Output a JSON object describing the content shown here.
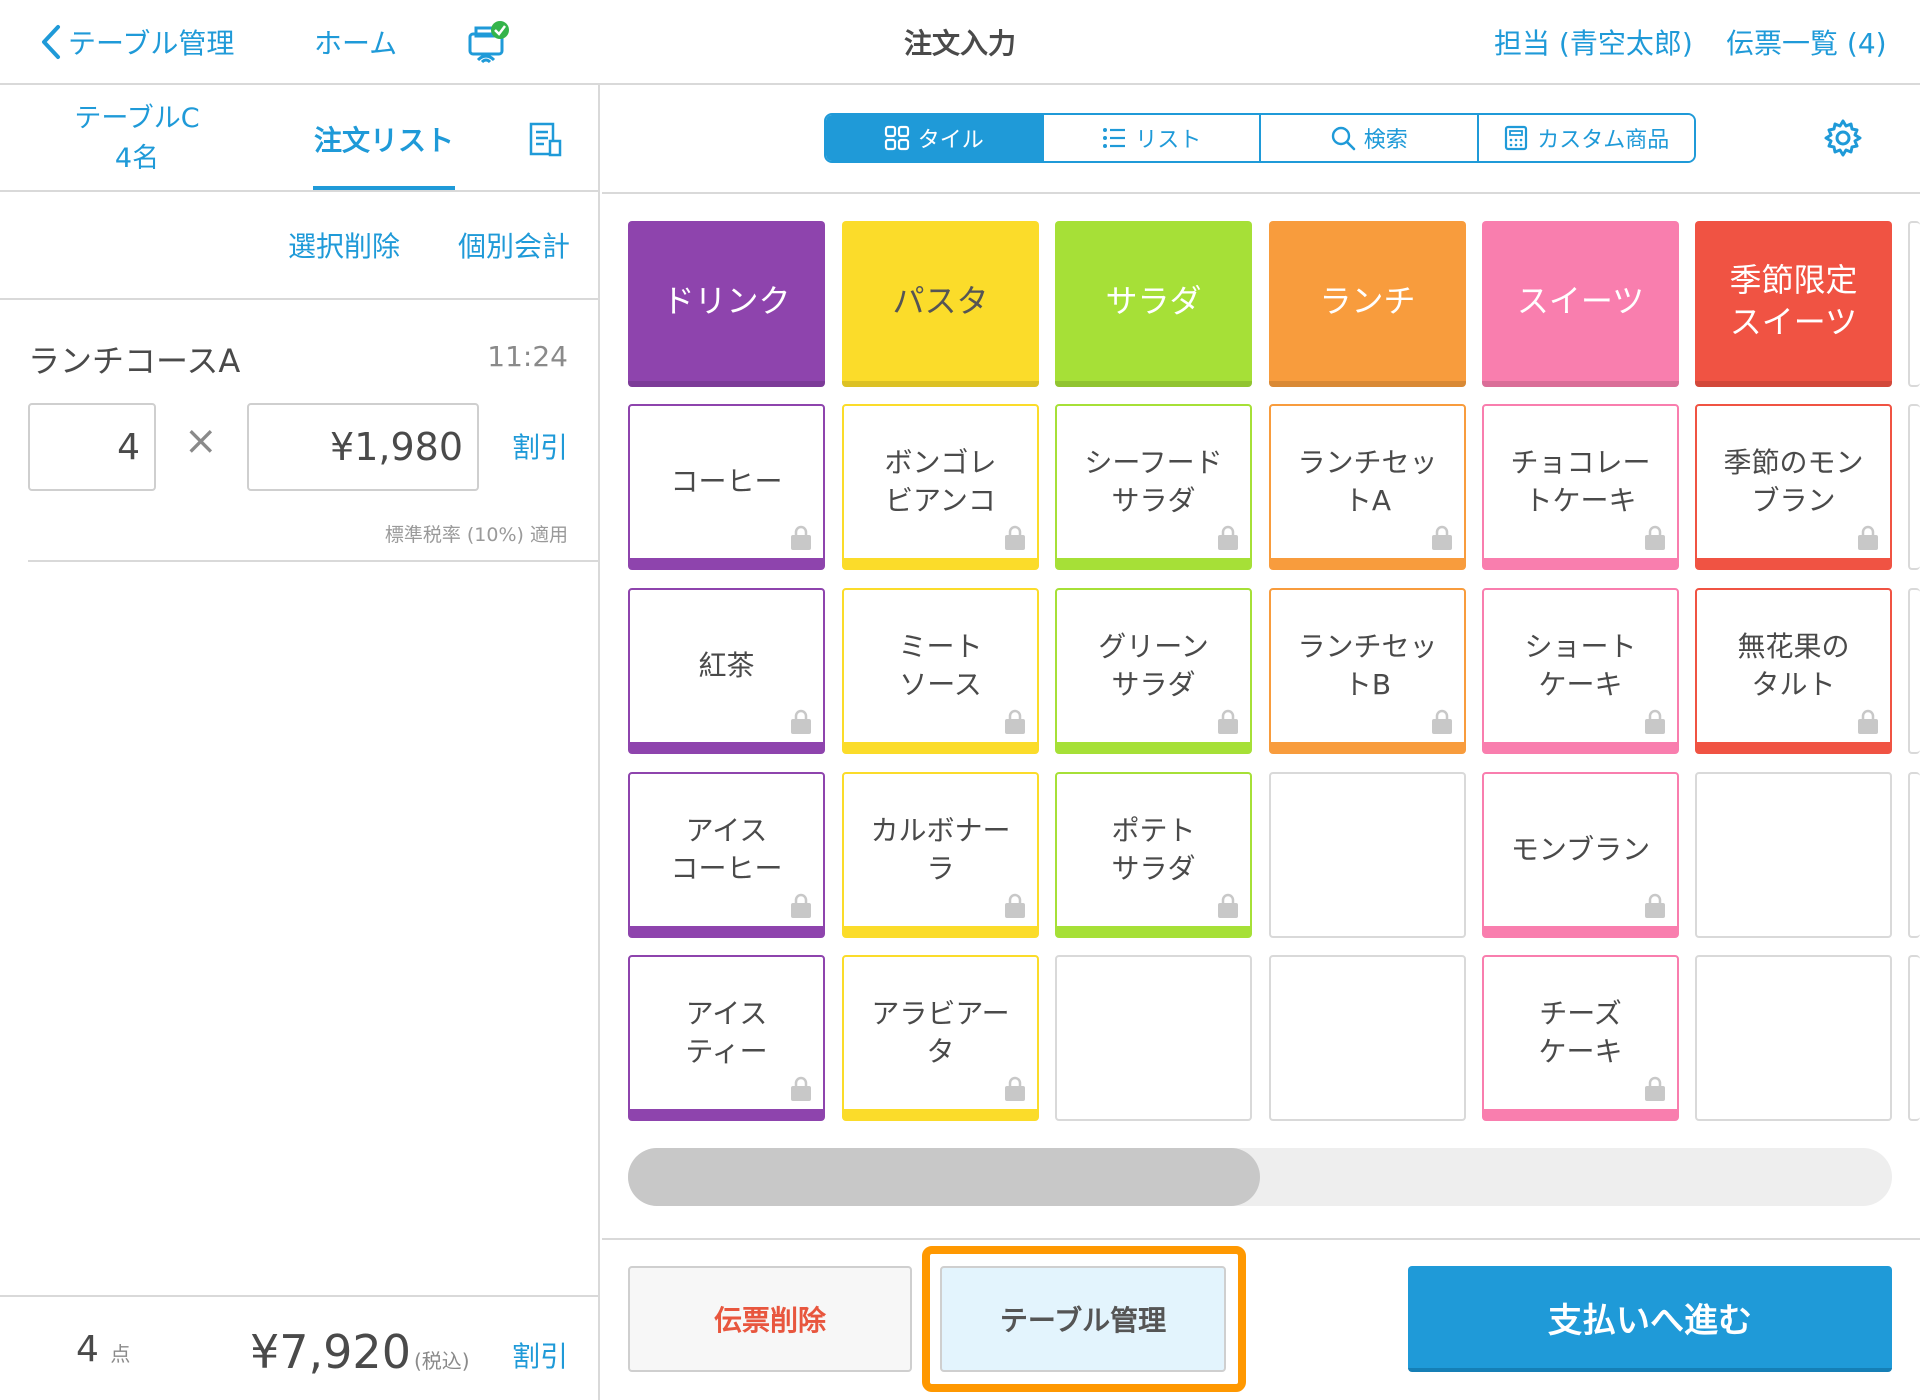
{
  "header": {
    "back_label": "テーブル管理",
    "home_label": "ホーム",
    "title": "注文入力",
    "staff_label": "担当 (青空太郎)",
    "slips_label": "伝票一覧 (4)"
  },
  "left": {
    "table_name": "テーブルC",
    "guests": "4名",
    "order_list_tab": "注文リスト",
    "delete_selected": "選択削除",
    "split_bill": "個別会計",
    "item": {
      "name": "ランチコースA",
      "time": "11:24",
      "quantity": "4",
      "times_symbol": "×",
      "price": "¥1,980",
      "discount": "割引",
      "tax_note": "標準税率 (10%) 適用"
    },
    "footer": {
      "count": "4",
      "count_unit": "点",
      "total": "¥7,920",
      "tax_included": "(税込)",
      "discount": "割引"
    }
  },
  "view_modes": [
    {
      "label": "タイル",
      "icon": "tile-grid-icon",
      "active": true
    },
    {
      "label": "リスト",
      "icon": "list-icon",
      "active": false
    },
    {
      "label": "検索",
      "icon": "search-icon",
      "active": false
    },
    {
      "label": "カスタム商品",
      "icon": "calculator-icon",
      "active": false
    }
  ],
  "categories": [
    {
      "label": "ドリンク",
      "color": "#8e44ad"
    },
    {
      "label": "パスタ",
      "color": "#fbdc2a"
    },
    {
      "label": "サラダ",
      "color": "#a6e037"
    },
    {
      "label": "ランチ",
      "color": "#f89c3d"
    },
    {
      "label": "スイーツ",
      "color": "#f97eae"
    },
    {
      "label": "季節限定\nスイーツ",
      "color": "#f05343"
    }
  ],
  "columns": [
    [
      "コーヒー",
      "紅茶",
      "アイス\nコーヒー",
      "アイス\nティー"
    ],
    [
      "ボンゴレ\nビアンコ",
      "ミート\nソース",
      "カルボナー\nラ",
      "アラビアー\nタ"
    ],
    [
      "シーフード\nサラダ",
      "グリーン\nサラダ",
      "ポテト\nサラダ",
      null
    ],
    [
      "ランチセッ\nトA",
      "ランチセッ\nトB",
      null,
      null
    ],
    [
      "チョコレー\nトケーキ",
      "ショート\nケーキ",
      "モンブラン",
      "チーズ\nケーキ"
    ],
    [
      "季節のモン\nブラン",
      "無花果の\nタルト",
      null,
      null
    ]
  ],
  "scroll_position": 0.5,
  "buttons": {
    "delete_slip": "伝票削除",
    "table_management": "テーブル管理",
    "proceed_payment": "支払いへ進む"
  }
}
